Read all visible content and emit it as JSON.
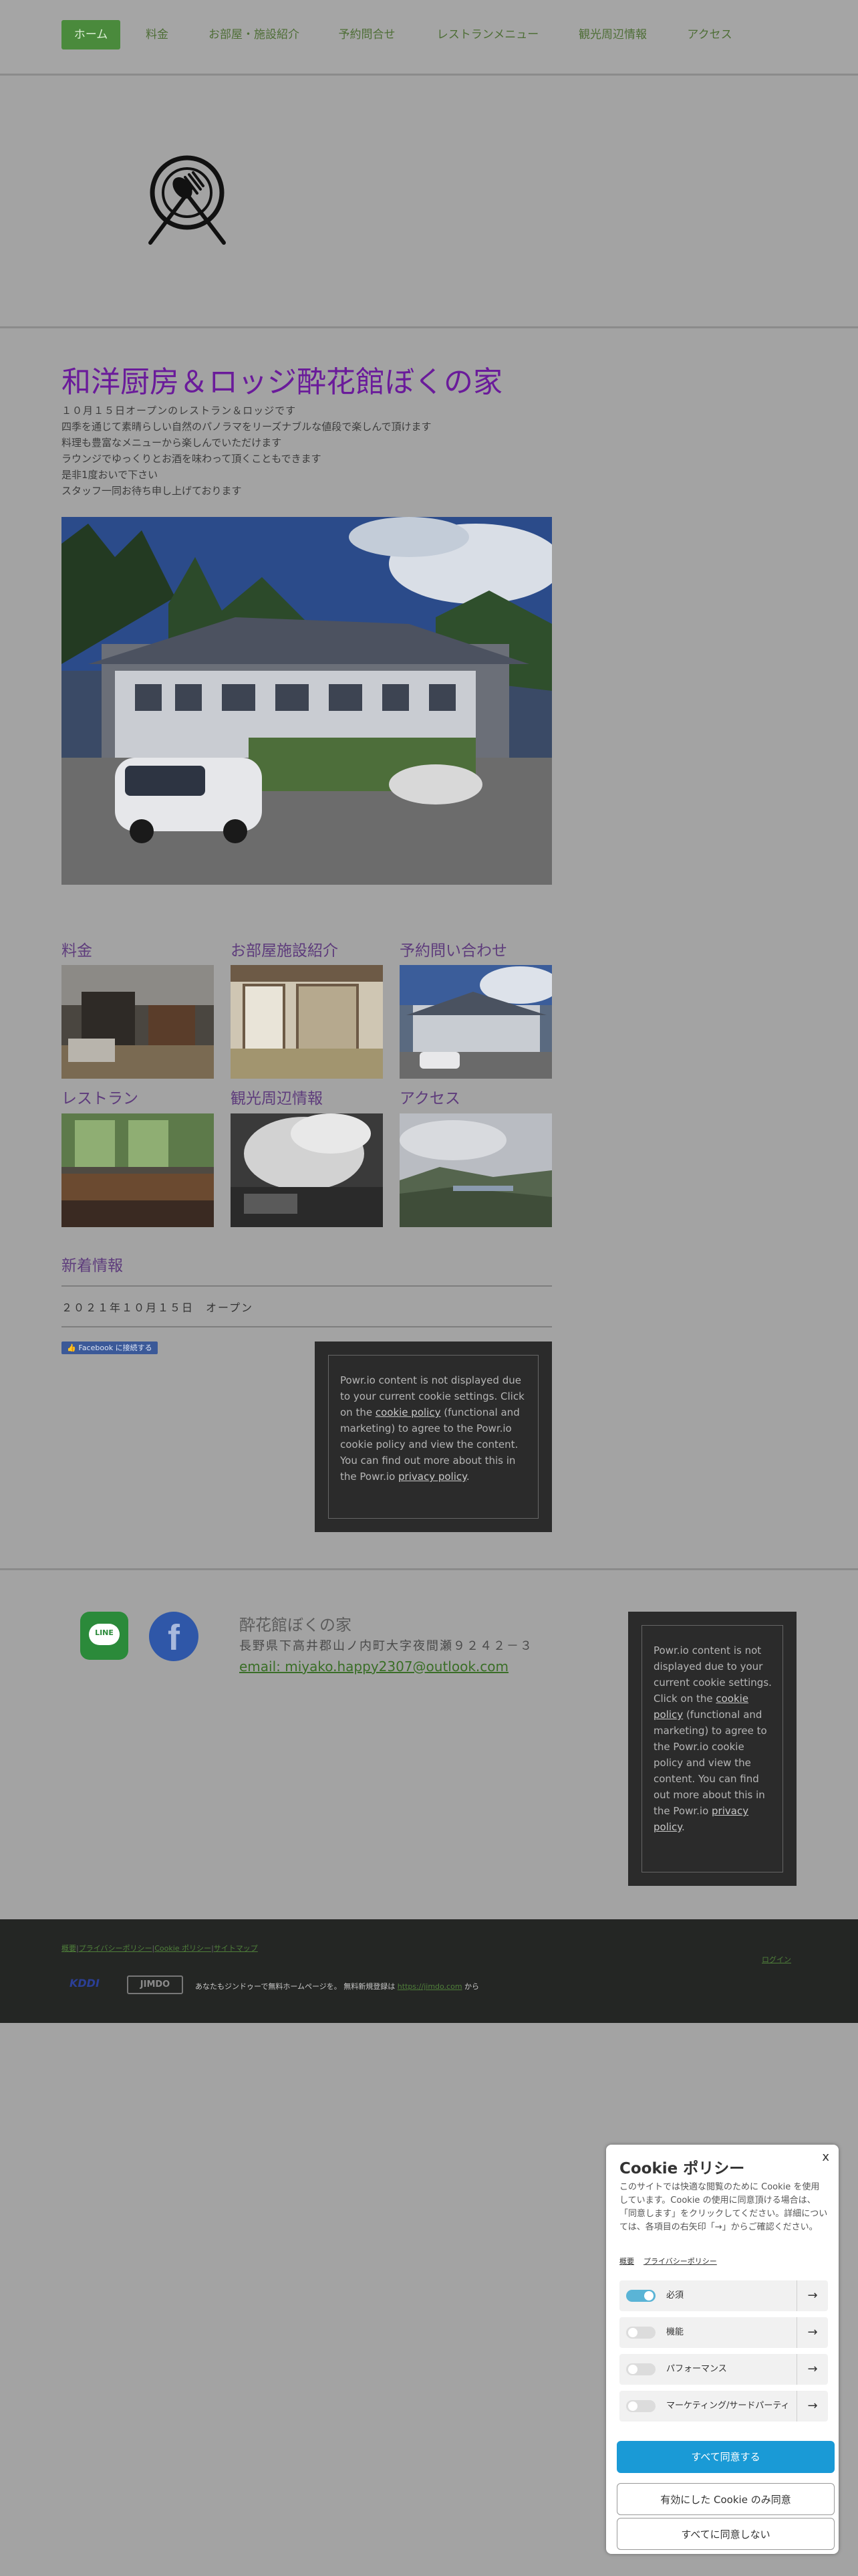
{
  "nav": {
    "items": [
      {
        "label": "ホーム",
        "active": true
      },
      {
        "label": "料金"
      },
      {
        "label": "お部屋・施設紹介"
      },
      {
        "label": "予約問合せ"
      },
      {
        "label": "レストランメニュー"
      },
      {
        "label": "観光周辺情報"
      },
      {
        "label": "アクセス"
      }
    ]
  },
  "logo": {
    "icon": "restaurant-plate-cutlery-icon"
  },
  "site": {
    "title": "和洋厨房＆ロッジ酔花館ぼくの家",
    "intro": [
      "１０月１５日オープンのレストラン＆ロッジです",
      "四季を通じて素晴らしい自然のパノラマをリーズナブルな値段で楽しんで頂けます",
      "料理も豊富なメニューから楽しんでいただけます",
      "ラウンジでゆっくりとお酒を味わって頂くこともできます",
      "是非1度おいで下さい",
      "スタッフ一同お待ち申し上げております"
    ]
  },
  "tiles": [
    {
      "label": "料金"
    },
    {
      "label": "お部屋施設紹介"
    },
    {
      "label": "予約問い合わせ"
    },
    {
      "label": "レストラン"
    },
    {
      "label": "観光周辺情報"
    },
    {
      "label": "アクセス"
    }
  ],
  "news": {
    "title": "新着情報",
    "items": [
      "２０２１年１０月１５日　オープン"
    ]
  },
  "facebook_button": "Facebook に接続する",
  "powr": {
    "text_before": "Powr.io content is not displayed due to your current cookie settings. Click on the ",
    "cookie_link": "cookie policy",
    "text_middle": " (functional and marketing) to agree to the Powr.io cookie policy and view the content. You can find out more about this in the Powr.io ",
    "privacy_link": "privacy policy",
    "text_end": "."
  },
  "footer": {
    "line_label": "LINE",
    "venue_name": "酔花館ぼくの家",
    "address": "長野県下高井郡山ノ内町大字夜間瀬９２４２－３",
    "email": "email: miyako.happy2307@outlook.com"
  },
  "bottom_bar": {
    "links": [
      "概要",
      "プライバシーポリシー",
      "Cookie ポリシー",
      "サイトマップ"
    ],
    "login": "ログイン",
    "brand1": "KDDI",
    "brand2": "JIMDO",
    "promo_text": "あなたもジンドゥーで無料ホームページを。 無料新規登録は ",
    "promo_link": "https://jimdo.com",
    "promo_end": " から"
  },
  "cookie": {
    "title": "Cookie ポリシー",
    "close": "x",
    "body": "このサイトでは快適な閲覧のために Cookie を使用しています。Cookie の使用に同意頂ける場合は、「同意します」をクリックしてください。詳細については、各項目の右矢印「→」からご確認ください。",
    "links": [
      "概要",
      "プライバシーポリシー"
    ],
    "categories": [
      {
        "label": "必須",
        "on": true
      },
      {
        "label": "機能",
        "on": false
      },
      {
        "label": "パフォーマンス",
        "on": false
      },
      {
        "label": "マーケティング/サードパーティ",
        "on": false
      }
    ],
    "accept_all": "すべて同意する",
    "accept_selected": "有効にした Cookie のみ同意",
    "reject_all": "すべてに同意しない"
  },
  "colors": {
    "accent": "#4a8a3c",
    "title": "#6a1b9a",
    "cookie_primary": "#1a9ad6"
  }
}
